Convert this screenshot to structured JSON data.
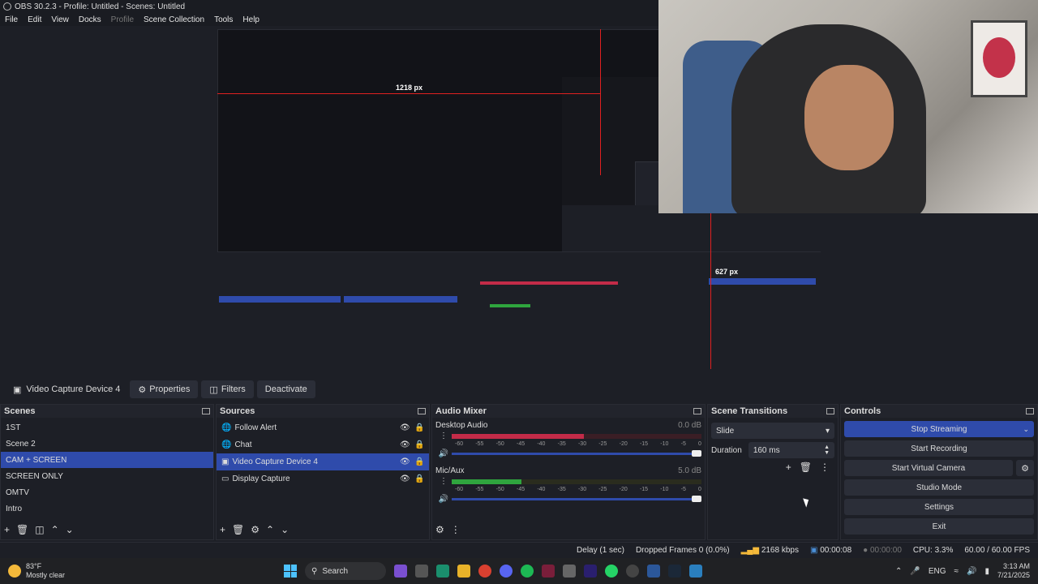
{
  "window": {
    "title": "OBS 30.2.3 - Profile: Untitled - Scenes: Untitled"
  },
  "menu": [
    {
      "label": "File",
      "enabled": true
    },
    {
      "label": "Edit",
      "enabled": true
    },
    {
      "label": "View",
      "enabled": true
    },
    {
      "label": "Docks",
      "enabled": true
    },
    {
      "label": "Profile",
      "enabled": false
    },
    {
      "label": "Scene Collection",
      "enabled": true
    },
    {
      "label": "Tools",
      "enabled": true
    },
    {
      "label": "Help",
      "enabled": true
    }
  ],
  "preview": {
    "measure_width": "1218 px",
    "measure_height": "627 px"
  },
  "source_toolbar": {
    "source_name": "Video Capture Device 4",
    "properties": "Properties",
    "filters": "Filters",
    "deactivate": "Deactivate"
  },
  "scenes": {
    "title": "Scenes",
    "items": [
      "1ST",
      "Scene 2",
      "CAM + SCREEN",
      "SCREEN ONLY",
      "OMTV",
      "Intro"
    ],
    "selected_index": 2
  },
  "sources": {
    "title": "Sources",
    "items": [
      "Follow Alert",
      "Chat",
      "Video Capture Device 4",
      "Display Capture"
    ],
    "selected_index": 2
  },
  "mixer": {
    "title": "Audio Mixer",
    "ticks": [
      "-60",
      "-55",
      "-50",
      "-45",
      "-40",
      "-35",
      "-30",
      "-25",
      "-20",
      "-15",
      "-10",
      "-5",
      "0"
    ],
    "channels": [
      {
        "name": "Desktop Audio",
        "db": "0.0 dB",
        "level": 0.53,
        "color": "#c32b48"
      },
      {
        "name": "Mic/Aux",
        "db": "5.0 dB",
        "level": 0.28,
        "color": "#2fa53e"
      }
    ]
  },
  "transitions": {
    "title": "Scene Transitions",
    "selected": "Slide",
    "duration_label": "Duration",
    "duration_value": "160 ms"
  },
  "controls": {
    "title": "Controls",
    "stop_streaming": "Stop Streaming",
    "start_recording": "Start Recording",
    "start_virtual_camera": "Start Virtual Camera",
    "studio_mode": "Studio Mode",
    "settings": "Settings",
    "exit": "Exit"
  },
  "status": {
    "delay": "Delay (1 sec)",
    "dropped": "Dropped Frames 0 (0.0%)",
    "bitrate": "2168 kbps",
    "stream_time": "00:00:08",
    "rec_time": "00:00:00",
    "cpu": "CPU: 3.3%",
    "fps": "60.00 / 60.00 FPS"
  },
  "taskbar": {
    "temp": "83°F",
    "weather": "Mostly clear",
    "search": "Search",
    "lang": "ENG",
    "time": "3:13 AM",
    "date": "7/21/2025"
  },
  "colors": {
    "accent": "#2f4bab",
    "meter_red": "#c32b48",
    "meter_green": "#2fa53e",
    "guide_red": "#e02020"
  }
}
